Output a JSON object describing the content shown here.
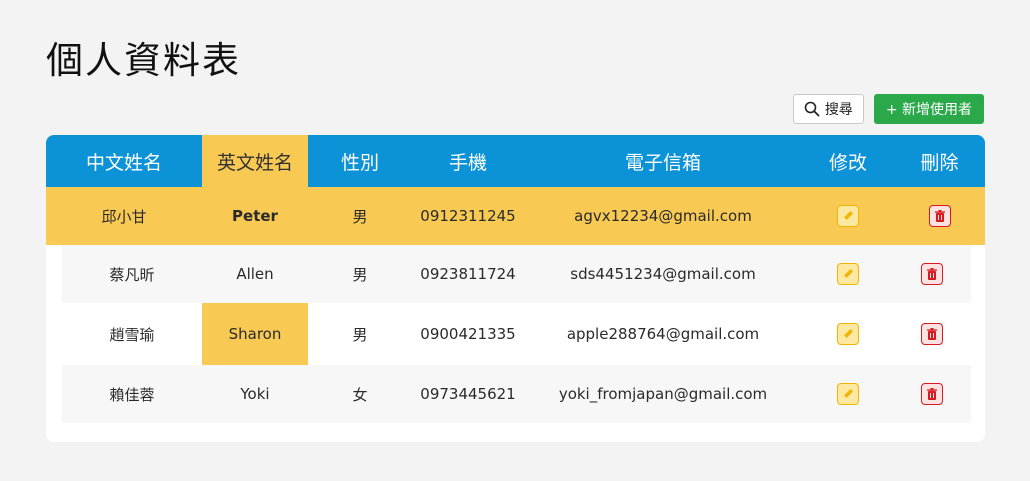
{
  "page": {
    "title": "個人資料表"
  },
  "toolbar": {
    "search_label": "搜尋",
    "add_label": "+ 新增使用者"
  },
  "table": {
    "headers": [
      "中文姓名",
      "英文姓名",
      "性別",
      "手機",
      "電子信箱",
      "修改",
      "刪除"
    ],
    "rows": [
      {
        "name_zh": "邱小甘",
        "name_en": "Peter",
        "gender": "男",
        "phone": "0912311245",
        "email": "agvx12234@gmail.com"
      },
      {
        "name_zh": "蔡凡昕",
        "name_en": "Allen",
        "gender": "男",
        "phone": "0923811724",
        "email": "sds4451234@gmail.com"
      },
      {
        "name_zh": "趙雪瑜",
        "name_en": "Sharon",
        "gender": "男",
        "phone": "0900421335",
        "email": "apple288764@gmail.com"
      },
      {
        "name_zh": "賴佳蓉",
        "name_en": "Yoki",
        "gender": "女",
        "phone": "0973445621",
        "email": "yoki_fromjapan@gmail.com"
      }
    ]
  },
  "colors": {
    "header_bg": "#0c92d7",
    "highlight": "#f8c953",
    "add_button": "#2aa84a",
    "edit_icon": "#f1b400",
    "delete_icon": "#d71920"
  },
  "icons": {
    "search": "search-icon",
    "edit": "pencil-icon",
    "delete": "trash-icon"
  }
}
